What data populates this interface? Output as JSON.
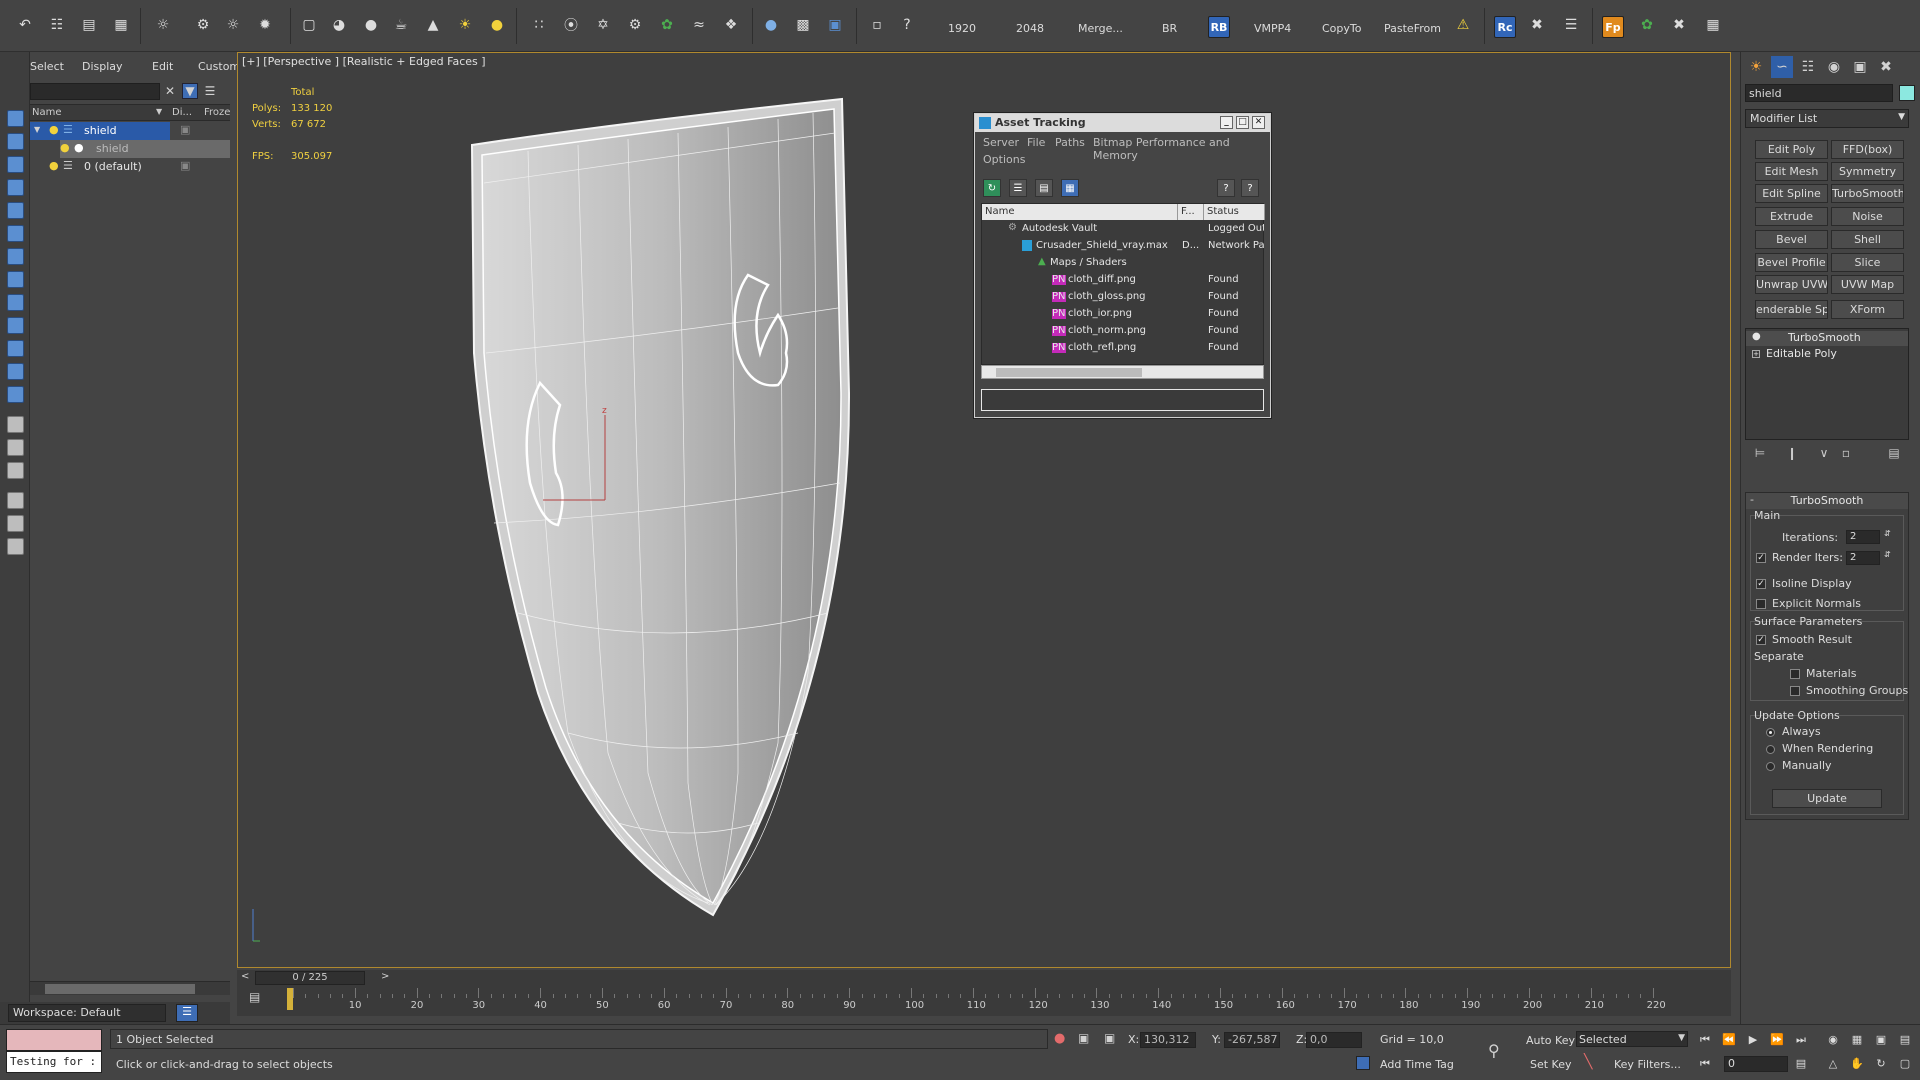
{
  "toolbar": {
    "btn_1920": "1920",
    "btn_2048": "2048",
    "btn_merge": "Merge...",
    "btn_br": "BR",
    "btn_rb": "RB",
    "btn_vmpp4": "VMPP4",
    "btn_copyto": "CopyTo",
    "btn_pastefrom": "PasteFrom",
    "btn_rc": "Rc",
    "btn_fp": "Fp"
  },
  "explorer": {
    "menu": [
      "Select",
      "Display",
      "Edit",
      "Customize"
    ],
    "columns": [
      "Name",
      "Di...",
      "Froze"
    ],
    "rows": [
      {
        "label": "shield",
        "level": 1,
        "selected": true
      },
      {
        "label": "shield",
        "level": 2,
        "selected": false
      },
      {
        "label": "0 (default)",
        "level": 1,
        "selected": false
      }
    ]
  },
  "workspace": {
    "label": "Workspace: Default"
  },
  "viewport": {
    "label": "[+] [Perspective ] [Realistic + Edged Faces ]",
    "stats_header": "Total",
    "polys_label": "Polys:",
    "polys_value": "133 120",
    "verts_label": "Verts:",
    "verts_value": "67 672",
    "fps_label": "FPS:",
    "fps_value": "305.097"
  },
  "asset_tracking": {
    "title": "Asset Tracking",
    "menu": [
      "Server",
      "File",
      "Paths",
      "Bitmap Performance and Memory",
      "Options"
    ],
    "columns": [
      "Name",
      "F...",
      "Status"
    ],
    "rows": [
      {
        "name": "Autodesk Vault",
        "f": "",
        "status": "Logged Out",
        "indent": 1
      },
      {
        "name": "Crusader_Shield_vray.max",
        "f": "D...",
        "status": "Network Pat",
        "indent": 2
      },
      {
        "name": "Maps / Shaders",
        "f": "",
        "status": "",
        "indent": 3
      },
      {
        "name": "cloth_diff.png",
        "f": "",
        "status": "Found",
        "indent": 4
      },
      {
        "name": "cloth_gloss.png",
        "f": "",
        "status": "Found",
        "indent": 4
      },
      {
        "name": "cloth_ior.png",
        "f": "",
        "status": "Found",
        "indent": 4
      },
      {
        "name": "cloth_norm.png",
        "f": "",
        "status": "Found",
        "indent": 4
      },
      {
        "name": "cloth_refl.png",
        "f": "",
        "status": "Found",
        "indent": 4
      }
    ],
    "png_tag": "PNG"
  },
  "command_panel": {
    "object_name": "shield",
    "modifier_list": "Modifier List",
    "modifier_buttons": [
      "Edit Poly",
      "FFD(box)",
      "Edit Mesh",
      "Symmetry",
      "Edit Spline",
      "TurboSmooth",
      "Extrude",
      "Noise",
      "Bevel",
      "Shell",
      "Bevel Profile",
      "Slice",
      "Unwrap UVW",
      "UVW Map",
      "enderable Splin",
      "XForm"
    ],
    "stack": [
      "TurboSmooth",
      "Editable Poly"
    ],
    "rollout": {
      "title": "TurboSmooth",
      "main_label": "Main",
      "iterations_label": "Iterations:",
      "iterations_value": "2",
      "render_iters_label": "Render Iters:",
      "render_iters_value": "2",
      "isoline_label": "Isoline Display",
      "explicit_normals_label": "Explicit Normals",
      "surface_params_label": "Surface Parameters",
      "smooth_result_label": "Smooth Result",
      "separate_label": "Separate",
      "materials_label": "Materials",
      "smoothing_groups_label": "Smoothing Groups",
      "update_options_label": "Update Options",
      "always_label": "Always",
      "when_rendering_label": "When Rendering",
      "manually_label": "Manually",
      "update_button": "Update"
    }
  },
  "timeline": {
    "slider_label": "0 / 225",
    "ticks": [
      "10",
      "20",
      "30",
      "40",
      "50",
      "60",
      "70",
      "80",
      "90",
      "100",
      "110",
      "120",
      "130",
      "140",
      "150",
      "160",
      "170",
      "180",
      "190",
      "200",
      "210",
      "220"
    ]
  },
  "status": {
    "maxscript_text": "Testing for :",
    "selected_text": "1 Object Selected",
    "prompt_text": "Click or click-and-drag to select objects",
    "x_label": "X:",
    "x_value": "130,312",
    "y_label": "Y:",
    "y_value": "-267,587",
    "z_label": "Z:",
    "z_value": "0,0",
    "grid_text": "Grid = 10,0",
    "add_time_tag": "Add Time Tag",
    "auto_key": "Auto Key",
    "set_key": "Set Key",
    "key_mode": "Selected",
    "key_filters": "Key Filters...",
    "frame_value": "0"
  },
  "colors": {
    "viewport_border": "#b0892e",
    "stat_text": "#f0d040",
    "selection": "#2a5aa8",
    "object_color": "#8ce8e0",
    "png_icon": "#c42ab9"
  }
}
